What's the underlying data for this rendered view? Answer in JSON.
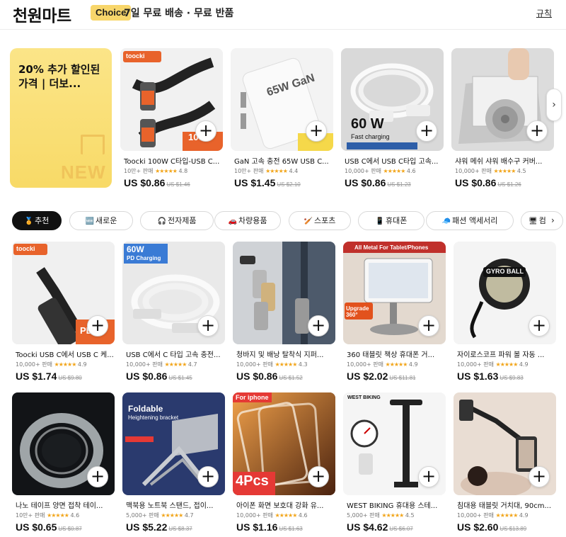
{
  "header": {
    "brand": "천원마트",
    "choice_badge": "Choice",
    "delivery": "7일 무료 배송 · 무료 반품",
    "rules_link": "규칙"
  },
  "promo": {
    "text": "20% 추가 할인된 가격 | 더보...",
    "badge": "NEW"
  },
  "top_products": [
    {
      "title": "Toocki 100W C타입-USB C...",
      "sold": "10만+ 판매",
      "rating": "4.8",
      "price": "US $0.86",
      "old_price": "US $1.46",
      "brand_label": "toocki",
      "badge_text": "100W"
    },
    {
      "title": "GaN 고속 충전 65W USB C...",
      "sold": "10만+ 판매",
      "rating": "4.4",
      "price": "US $1.45",
      "old_price": "US $2.10",
      "brand_label": "65W GaN"
    },
    {
      "title": "USB C에서 USB C타입 고속...",
      "sold": "10,000+ 판매",
      "rating": "4.6",
      "price": "US $0.86",
      "old_price": "US $1.23",
      "badge_text": "60 W",
      "caption": "Fast charging"
    },
    {
      "title": "샤워 메쉬 샤워 배수구 커버...",
      "sold": "10,000+ 판매",
      "rating": "4.5",
      "price": "US $0.86",
      "old_price": "US $1.26"
    }
  ],
  "categories": [
    {
      "icon": "medal-icon",
      "glyph": "🏅",
      "label": "추천",
      "active": true
    },
    {
      "icon": "new-icon",
      "glyph": "🆕",
      "label": "새로운"
    },
    {
      "icon": "headphones-icon",
      "glyph": "🎧",
      "label": "전자제품"
    },
    {
      "icon": "car-icon",
      "glyph": "🚗",
      "label": "차량용품"
    },
    {
      "icon": "sports-icon",
      "glyph": "🏏",
      "label": "스포츠"
    },
    {
      "icon": "phone-icon",
      "glyph": "📱",
      "label": "휴대폰"
    },
    {
      "icon": "cap-icon",
      "glyph": "🧢",
      "label": "패션 액세서리"
    },
    {
      "icon": "computer-icon",
      "glyph": "🖥",
      "label": "컴"
    }
  ],
  "grid_products": [
    {
      "title": "Toocki USB C에서 USB C 케...",
      "sold": "10,000+ 판매",
      "rating": "4.9",
      "price": "US $1.74",
      "old_price": "US $9.80",
      "brand_label": "toocki",
      "badge_text": "PD"
    },
    {
      "title": "USB C에서 C 타입 고속 충전...",
      "sold": "10,000+ 판매",
      "rating": "4.7",
      "price": "US $0.86",
      "old_price": "US $1.45",
      "badge_text": "60W",
      "caption": "PD Charging"
    },
    {
      "title": "청바지 및 배낭 탈착식 지퍼...",
      "sold": "10,000+ 판매",
      "rating": "4.3",
      "price": "US $0.86",
      "old_price": "US $1.52"
    },
    {
      "title": "360 태블릿 책상 휴대폰 거...",
      "sold": "10,000+ 판매",
      "rating": "4.9",
      "price": "US $2.02",
      "old_price": "US $11.81",
      "caption": "All Metal For Tablet/Phones",
      "badge_text": "Upgrade 360°"
    },
    {
      "title": "자이로스코프 파워 볼 자동 ...",
      "sold": "10,000+ 판매",
      "rating": "4.9",
      "price": "US $1.63",
      "old_price": "US $9.83",
      "caption": "GYRO BALL"
    },
    {
      "title": "나노 테이프 양면 접착 테이...",
      "sold": "10만+ 판매",
      "rating": "4.6",
      "price": "US $0.65",
      "old_price": "US $0.87"
    },
    {
      "title": "맥북용 노트북 스탠드, 접이...",
      "sold": "5,000+ 판매",
      "rating": "4.7",
      "price": "US $5.22",
      "old_price": "US $8.37",
      "caption": "Foldable",
      "sub_caption": "Heightening bracket"
    },
    {
      "title": "아이폰 화면 보호대 강화 유...",
      "sold": "10,000+ 판매",
      "rating": "4.6",
      "price": "US $1.16",
      "old_price": "US $1.63",
      "caption": "For iphone",
      "badge_text": "4Pcs"
    },
    {
      "title": "WEST BIKING 휴대용 스테...",
      "sold": "5,000+ 판매",
      "rating": "4.5",
      "price": "US $4.62",
      "old_price": "US $6.07",
      "brand_label": "WEST BIKING"
    },
    {
      "title": "침대용 태블릿 거치대, 90cm...",
      "sold": "10,000+ 판매",
      "rating": "4.9",
      "price": "US $2.60",
      "old_price": "US $13.89"
    }
  ],
  "ui": {
    "plus": "+",
    "stars": "★★★★★",
    "next_arrow": "›"
  },
  "colors": {
    "choice": "#f8d66b",
    "star": "#f2a51a",
    "promo_bg": "#f8da67"
  }
}
